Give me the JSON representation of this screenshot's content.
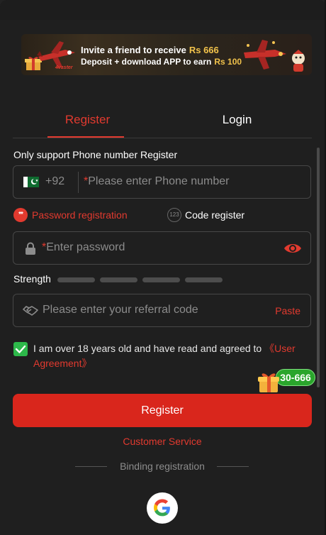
{
  "banner": {
    "line1_text": "Invite a friend to receive",
    "line1_amount": "Rs 666",
    "line2_text": "Deposit + download APP to earn",
    "line2_amount": "Rs 100",
    "brand": "4vaster"
  },
  "tabs": [
    {
      "label": "Register",
      "active": true
    },
    {
      "label": "Login",
      "active": false
    }
  ],
  "form": {
    "section_title": "Only support Phone number Register",
    "phone": {
      "country_code": "+92",
      "required_mark": "*",
      "placeholder": "Please enter Phone number"
    },
    "options": {
      "password_icon_text": "**",
      "password_label": "Password registration",
      "code_icon_text": "123",
      "code_label": "Code register"
    },
    "password": {
      "required_mark": "*",
      "placeholder": "Enter password"
    },
    "strength": {
      "label": "Strength",
      "bars": 4,
      "filled": 0
    },
    "referral": {
      "placeholder": "Please enter your referral code",
      "paste_label": "Paste"
    },
    "agreement": {
      "checked": true,
      "text": "I am over 18 years old and have read and agreed to ",
      "link": "《User Agreement》"
    },
    "submit_label": "Register"
  },
  "promo": {
    "badge": "30-666"
  },
  "footer": {
    "customer_service": "Customer Service",
    "binding": "Binding registration",
    "google_icon": "google-icon"
  },
  "colors": {
    "accent": "#e23a2f",
    "button": "#d9261c",
    "background": "#1f1f1f",
    "checkbox": "#2db84a"
  }
}
